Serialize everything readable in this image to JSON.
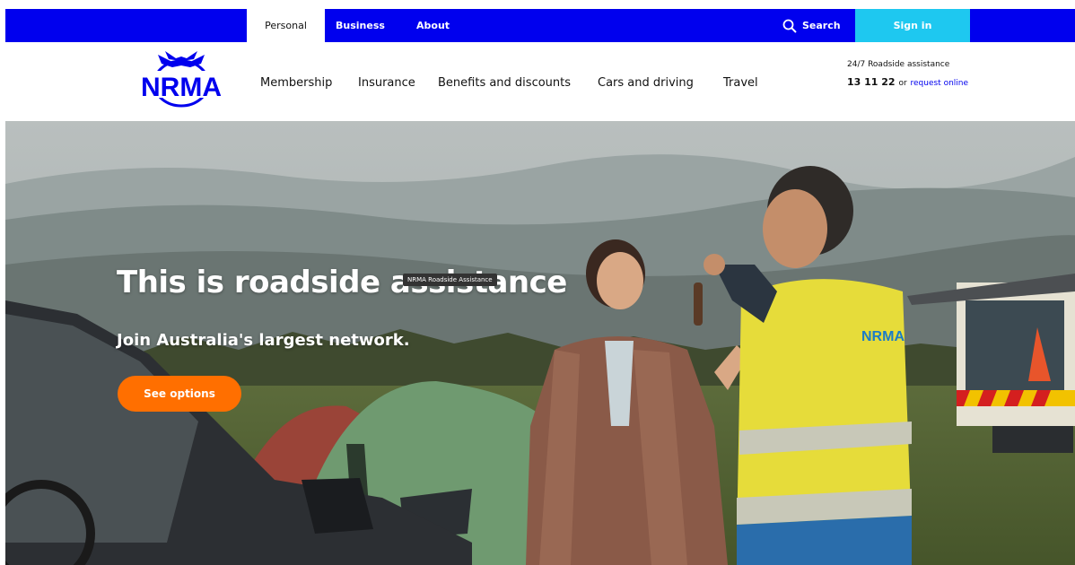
{
  "topbar": {
    "tabs": [
      "Personal",
      "Business",
      "About"
    ],
    "search_label": "Search",
    "signin_label": "Sign in"
  },
  "brand": {
    "logo_text": "NRMA",
    "primary_color": "#0000ee",
    "accent_color": "#ff6f00",
    "signin_color": "#1ec8f0"
  },
  "nav": {
    "items": [
      "Membership",
      "Insurance",
      "Benefits and discounts",
      "Cars and driving",
      "Travel"
    ]
  },
  "roadside": {
    "label": "24/7 Roadside assistance",
    "phone": "13 11 22",
    "or": "or",
    "link": "request online"
  },
  "hero": {
    "title": "This is roadside assistance",
    "subtitle": "Join Australia's largest network.",
    "button": "See options",
    "tooltip": "NRMA Roadside Assistance",
    "badge_text": "NRMA"
  }
}
